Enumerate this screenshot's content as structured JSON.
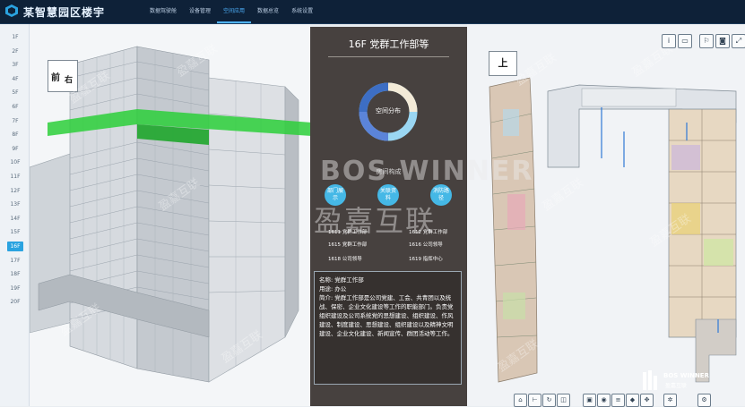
{
  "app": {
    "title": "某智慧园区楼宇"
  },
  "nav": [
    {
      "label": "数据驾驶舱",
      "active": false
    },
    {
      "label": "设备管理",
      "active": false
    },
    {
      "label": "空间应用",
      "active": true
    },
    {
      "label": "数据总览",
      "active": false
    },
    {
      "label": "系统设置",
      "active": false
    }
  ],
  "floors": [
    "1F",
    "2F",
    "3F",
    "4F",
    "5F",
    "6F",
    "7F",
    "8F",
    "9F",
    "10F",
    "11F",
    "12F",
    "13F",
    "14F",
    "15F",
    "16F",
    "17F",
    "18F",
    "19F",
    "20F"
  ],
  "active_floor": "16F",
  "viewcube_3d": {
    "left": "前",
    "right": "右"
  },
  "viewcube_plan": {
    "top": "上"
  },
  "panel": {
    "title": "16F  党群工作部等",
    "donut_label": "空间分布",
    "composition_title": "房间构成",
    "buttons": [
      "部门展示",
      "关联资料",
      "消防路径"
    ],
    "rooms": [
      "1611 党群工作部",
      "1612 党群工作部",
      "1615 党群工作部",
      "1616 公司领导",
      "1618 公司领导",
      "1619 指挥中心"
    ],
    "info": {
      "name": "名称:  党群工作部",
      "use": "用途:  办公",
      "intro": "简介:  党群工作部是公司党建、工会、共青团以及统战、保密、企业文化建设等工作的职能部门。负责党组织建设及公司系统党的思想建设、组织建设、作风建设、制度建设、思想建设、组织建设以及精神文明建设、企业文化建设、新闻宣传、群团活动等工作。"
    }
  },
  "watermarks": {
    "main": "BOS WINNER",
    "sub": "盈嘉互联",
    "brand_en": "BOS WINNER",
    "brand_cn": "盈嘉互联"
  },
  "colors": {
    "accent": "#4fb3ff",
    "topbar": "#0e2138",
    "panel": "#3a3431",
    "green": "#2ccf3a"
  },
  "icons": {
    "top_right": [
      "info-icon",
      "ruler-icon",
      "bookmark-icon",
      "camera-icon",
      "fullscreen-icon"
    ],
    "bottom": [
      "home-icon",
      "measure-icon",
      "rotate-icon",
      "section-icon",
      "view-icon",
      "visibility-icon",
      "layers-icon",
      "cube-icon",
      "move-icon",
      "explode-icon",
      "settings-icon"
    ]
  }
}
